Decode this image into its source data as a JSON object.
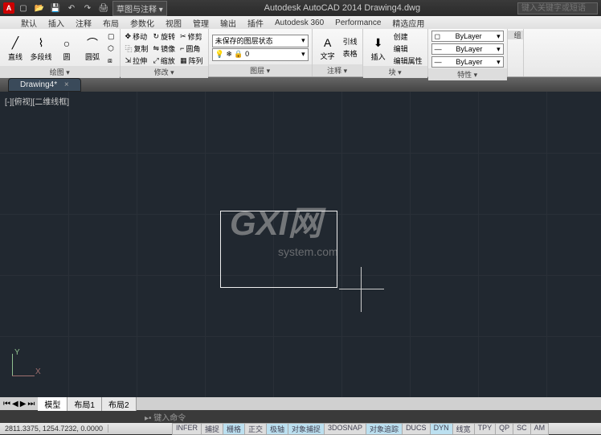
{
  "titlebar": {
    "app_letter": "A",
    "workspace": "草图与注释",
    "app_title": "Autodesk AutoCAD 2014   Drawing4.dwg",
    "search_placeholder": "键入关键字或短语"
  },
  "menubar": {
    "items": [
      "默认",
      "插入",
      "注释",
      "布局",
      "参数化",
      "视图",
      "管理",
      "输出",
      "插件",
      "Autodesk 360",
      "Performance",
      "精选应用"
    ]
  },
  "ribbon": {
    "draw": {
      "title": "绘图 ▾",
      "line": "直线",
      "polyline": "多段线",
      "circle": "圆",
      "arc": "圆弧"
    },
    "modify": {
      "title": "修改 ▾",
      "move": "移动",
      "copy": "复制",
      "stretch": "拉伸",
      "rotate": "旋转",
      "mirror": "镜像",
      "scale": "缩放",
      "trim": "修剪",
      "fillet": "圆角",
      "array": "阵列"
    },
    "layers": {
      "title": "图层 ▾",
      "unsaved": "未保存的图层状态"
    },
    "annotation": {
      "title": "注释 ▾",
      "text": "文字",
      "leader": "引线",
      "table": "表格"
    },
    "block": {
      "title": "块 ▾",
      "insert": "插入",
      "create": "创建",
      "edit": "编辑",
      "editattr": "编辑属性"
    },
    "properties": {
      "title": "特性 ▾",
      "bylayer": "ByLayer"
    },
    "group": {
      "title": "组"
    }
  },
  "filetab": {
    "name": "Drawing4*",
    "close": "×"
  },
  "viewport": {
    "label": "[-][俯视][二维线框]"
  },
  "watermark": {
    "big": "GXI",
    "suffix": "网",
    "url": "system.com"
  },
  "ucs": {
    "x": "X",
    "y": "Y"
  },
  "layout_tabs": {
    "model": "模型",
    "layout1": "布局1",
    "layout2": "布局2"
  },
  "commandline": {
    "prompt": "▸• 键入命令"
  },
  "statusbar": {
    "coords": "2811.3375, 1254.7232, 0.0000",
    "buttons": [
      "INFER",
      "捕捉",
      "栅格",
      "正交",
      "极轴",
      "对象捕捉",
      "3DOSNAP",
      "对象追踪",
      "DUCS",
      "DYN",
      "线宽",
      "TPY",
      "QP",
      "SC",
      "AM"
    ]
  }
}
